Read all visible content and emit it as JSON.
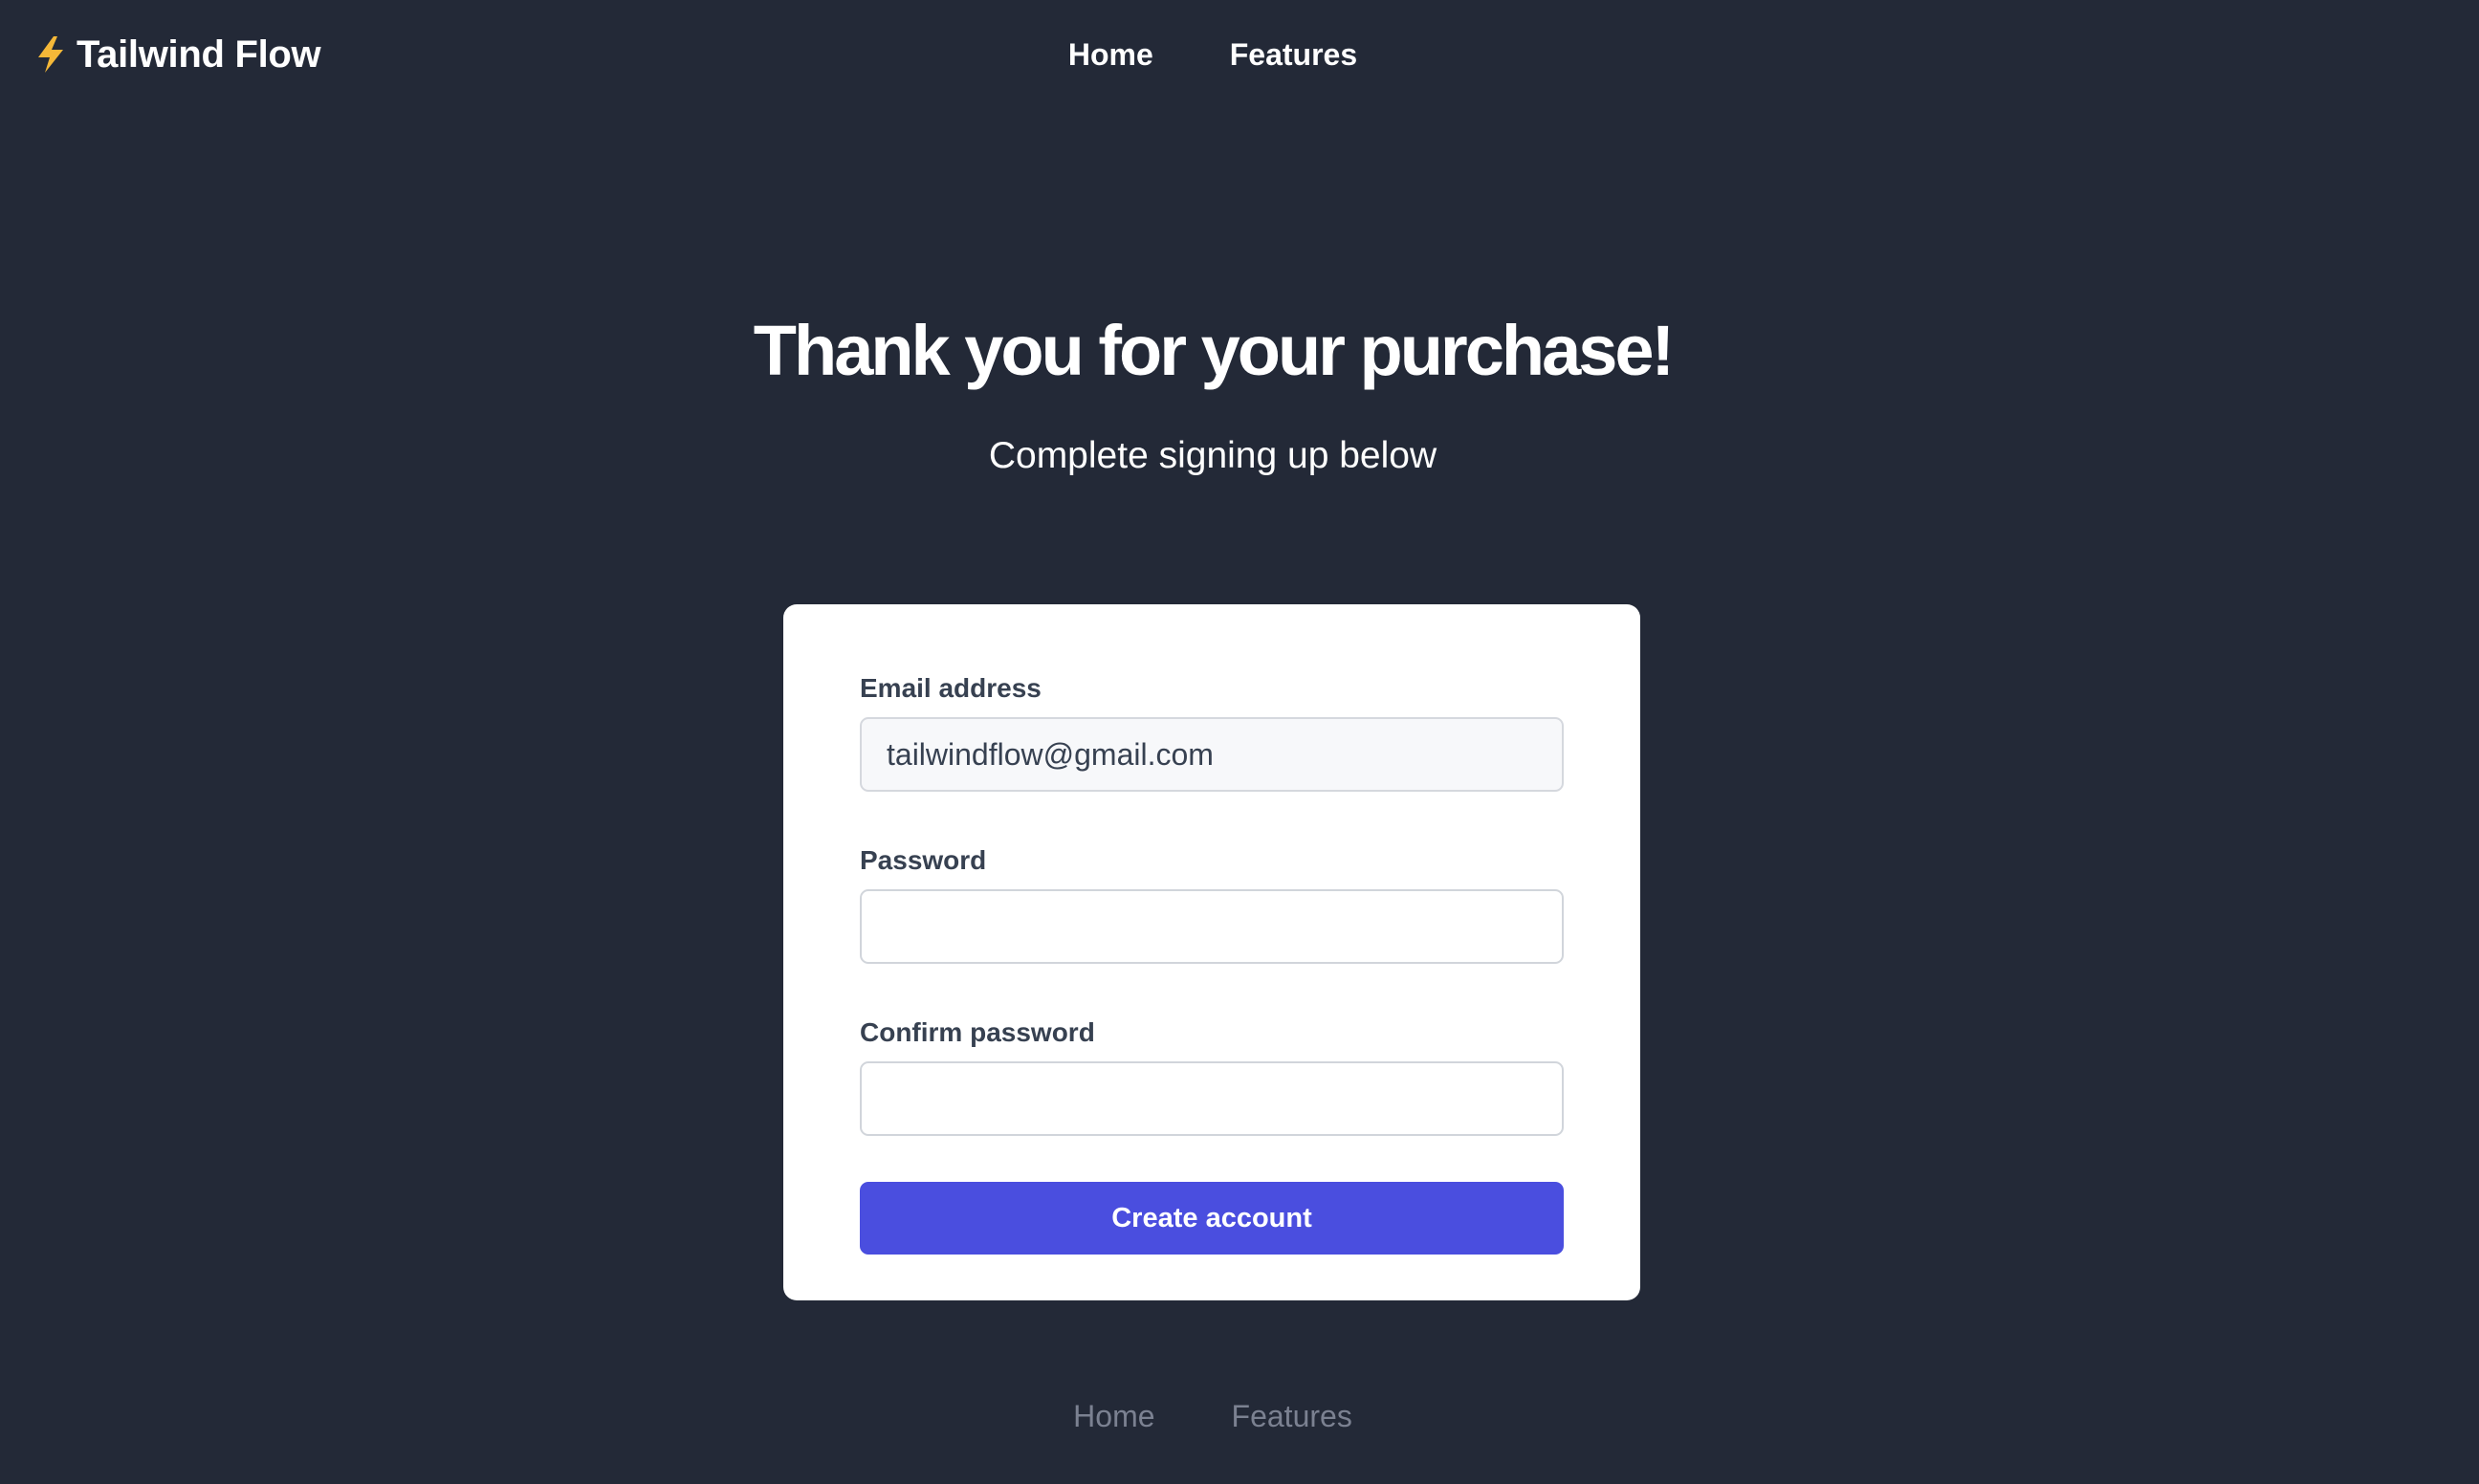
{
  "header": {
    "brand_name": "Tailwind Flow",
    "brand_icon": "lightning-bolt-icon",
    "nav": [
      {
        "label": "Home"
      },
      {
        "label": "Features"
      }
    ]
  },
  "hero": {
    "title": "Thank you for your purchase!",
    "subtitle": "Complete signing up below"
  },
  "form": {
    "email": {
      "label": "Email address",
      "value": "tailwindflow@gmail.com",
      "placeholder": ""
    },
    "password": {
      "label": "Password",
      "value": "",
      "placeholder": ""
    },
    "confirm_password": {
      "label": "Confirm password",
      "value": "",
      "placeholder": ""
    },
    "submit_label": "Create account"
  },
  "footer": {
    "nav": [
      {
        "label": "Home"
      },
      {
        "label": "Features"
      }
    ]
  },
  "colors": {
    "background": "#232937",
    "accent": "#4a4edf",
    "bolt": "#f5b838",
    "footer_link": "#7b8191"
  }
}
